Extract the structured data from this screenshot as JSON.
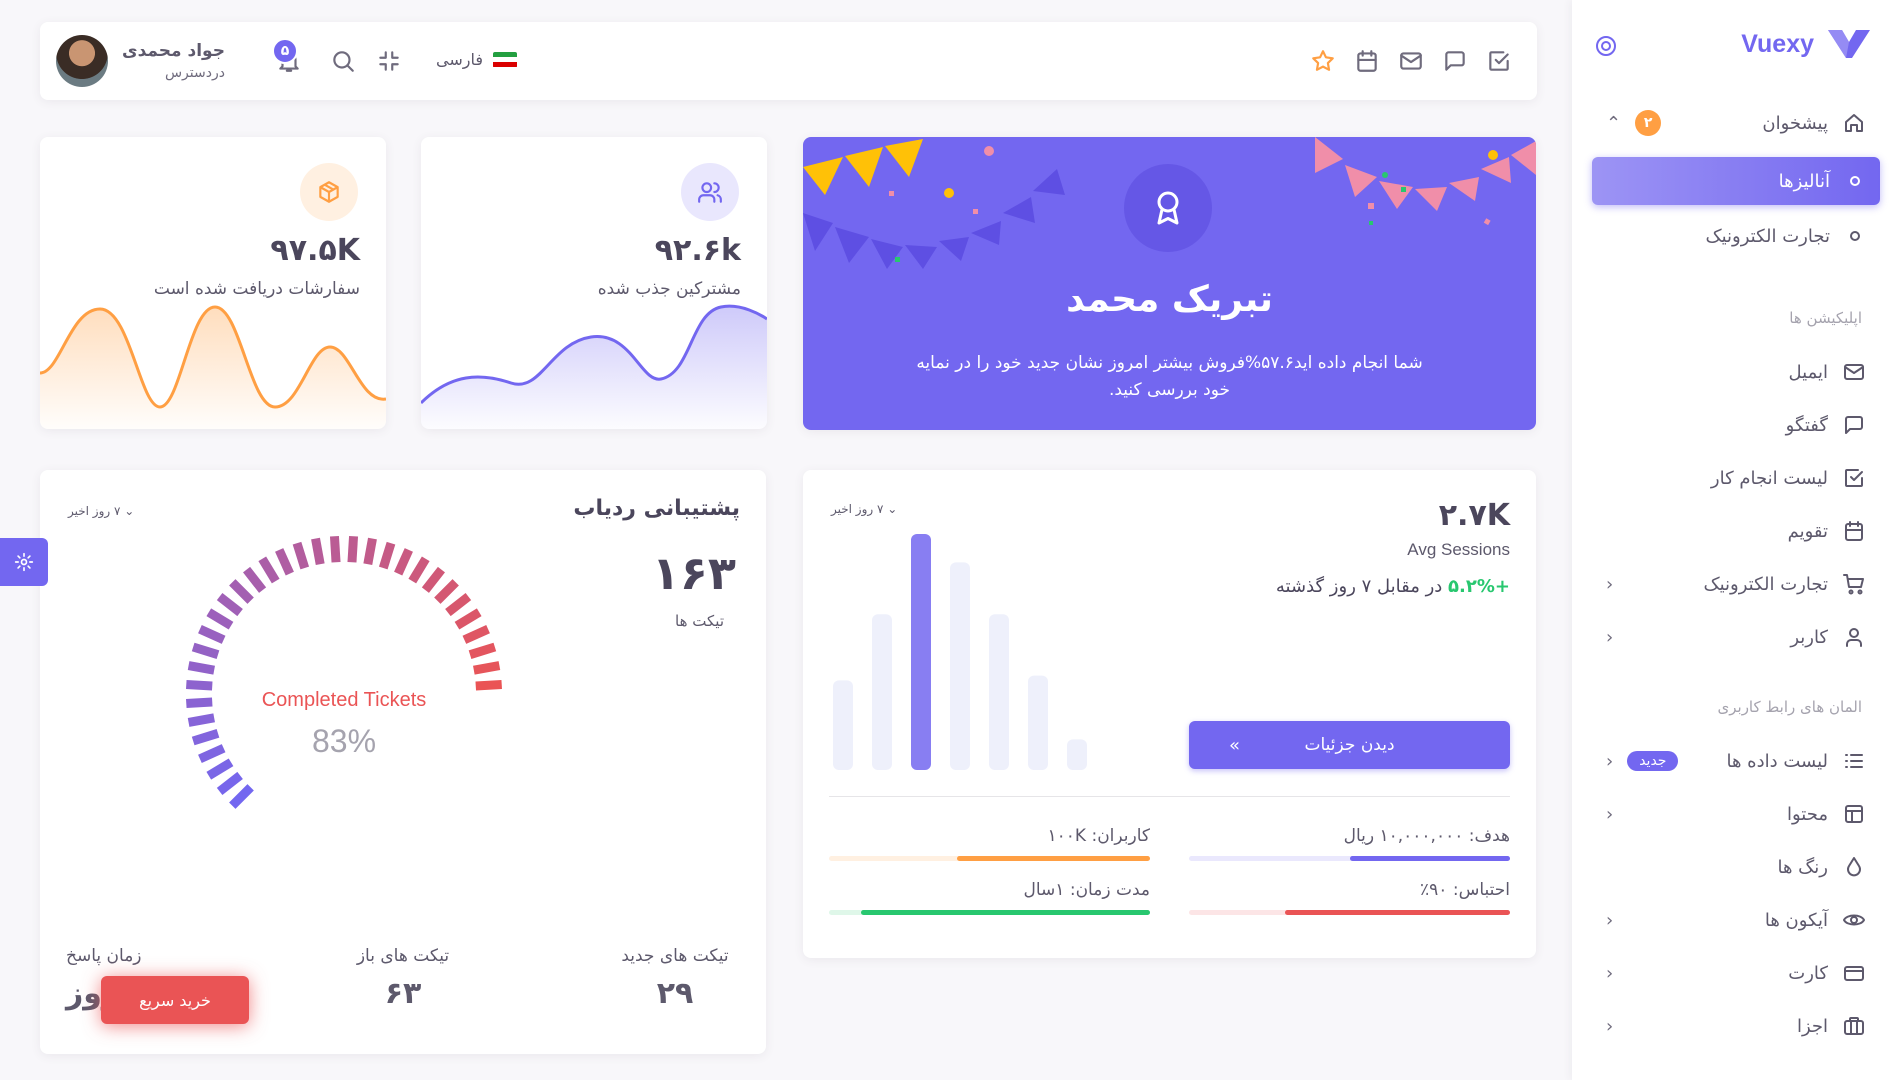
{
  "brand": {
    "name": "Vuexy",
    "accent": "#7367f0"
  },
  "topbar": {
    "user_name": "جواد محمدی",
    "user_role": "دردسترس",
    "notifications_count": "۵",
    "language": "فارسی"
  },
  "sidebar": {
    "dashboard": {
      "label": "پیشخوان",
      "badge": "۲"
    },
    "dashboard_subitems": [
      {
        "label": "آنالیزها",
        "active": true
      },
      {
        "label": "تجارت الکترونیک",
        "active": false
      }
    ],
    "apps_header": "اپلیکیشن ها",
    "apps": [
      {
        "label": "ایمیل",
        "icon": "mail-icon"
      },
      {
        "label": "گفتگو",
        "icon": "chat-icon"
      },
      {
        "label": "لیست انجام کار",
        "icon": "check-square-icon"
      },
      {
        "label": "تقویم",
        "icon": "calendar-icon"
      },
      {
        "label": "تجارت الکترونیک",
        "icon": "cart-icon",
        "has_children": true
      },
      {
        "label": "کاربر",
        "icon": "user-icon",
        "has_children": true
      }
    ],
    "ui_header": "المان های رابط کاربری",
    "ui": [
      {
        "label": "لیست داده ها",
        "icon": "list-icon",
        "badge": "جدید",
        "has_children": true
      },
      {
        "label": "محتوا",
        "icon": "layout-icon",
        "has_children": true
      },
      {
        "label": "رنگ ها",
        "icon": "droplet-icon"
      },
      {
        "label": "آیکون ها",
        "icon": "eye-icon",
        "has_children": true
      },
      {
        "label": "کارت",
        "icon": "credit-card-icon",
        "has_children": true
      },
      {
        "label": "اجزا",
        "icon": "briefcase-icon",
        "has_children": true
      }
    ]
  },
  "congrats": {
    "title": "تبریک محمد",
    "text": "شما انجام داده اید۵۷.۶%فروش بیشتر امروز نشان جدید خود را در نمایه خود بررسی کنید."
  },
  "stats": {
    "customers": {
      "value": "۹۲.۶k",
      "label": "مشترکین جذب شده"
    },
    "orders": {
      "value": "۹۷.۵K",
      "label": "سفارشات دریافت شده است"
    }
  },
  "sessions": {
    "value": "۲.۷K",
    "subtitle": "Avg Sessions",
    "growth": "+۵.۲%",
    "growth_suffix": "در مقابل ۷ روز گذشته",
    "range": "۷ روز اخیر",
    "button": "دیدن جزئیات",
    "bars": [
      38,
      66,
      100,
      88,
      66,
      40,
      13
    ],
    "highlight_bar": 2,
    "progress": [
      {
        "label": "هدف: ۱۰,۰۰۰,۰۰۰ ریال",
        "value": 0.5,
        "color": "#7367f0",
        "track": "#eae8fd"
      },
      {
        "label": "کاربران: ۱۰۰K",
        "value": 0.6,
        "color": "#ff9f43",
        "track": "#fff0e1"
      },
      {
        "label": "احتباس: ۹۰٪",
        "value": 0.7,
        "color": "#ea5455",
        "track": "#fce5e6"
      },
      {
        "label": "مدت زمان: ۱سال",
        "value": 0.9,
        "color": "#28c76f",
        "track": "#dff7e9"
      }
    ]
  },
  "support": {
    "title": "پشتیبانی ردیاب",
    "range": "۷ روز اخیر",
    "total": "۱۶۳",
    "total_label": "تیکت ها",
    "gauge_label": "Completed Tickets",
    "gauge_value": "83%",
    "gauge_fraction": 0.83,
    "footer": [
      {
        "label": "تیکت های جدید",
        "value": "۲۹"
      },
      {
        "label": "تیکت های باز",
        "value": "۶۳"
      },
      {
        "label": "زمان پاسخ",
        "value": "۱روز"
      }
    ],
    "buy_button": "خرید سریع"
  }
}
